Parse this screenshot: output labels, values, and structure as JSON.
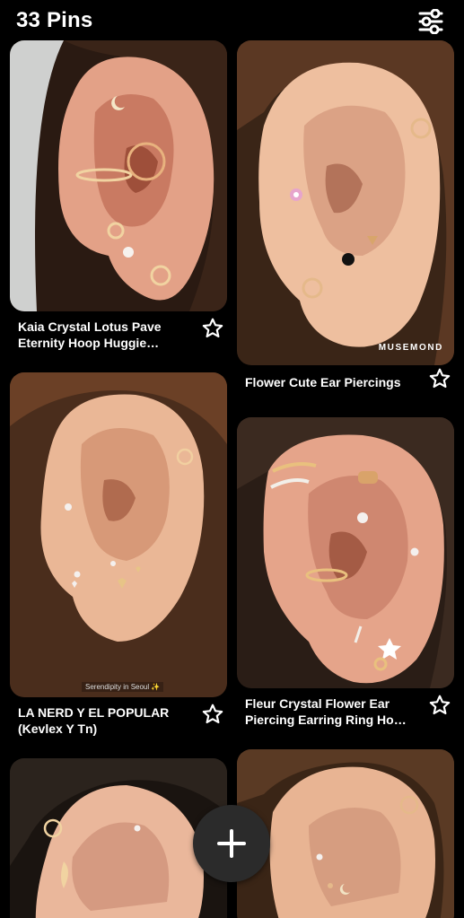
{
  "header": {
    "title": "33 Pins",
    "filter_icon": "sliders-icon"
  },
  "pins": [
    {
      "title": "Kaia Crystal Lotus Pave Eternity Hoop Huggie Earrin...",
      "image": "ear-piercings-moon-helix-daith"
    },
    {
      "title": "Flower Cute Ear Piercings",
      "image": "ear-piercings-flower-studs",
      "watermark": "MUSEMOND"
    },
    {
      "title": "LA NERD Y EL POPULAR (Kevlex Y Tn)",
      "image": "ear-piercings-star-studs",
      "watermark": "Serendipity in Seoul ✨"
    },
    {
      "title": "Fleur Crystal Flower Ear Piercing Earring Ring Hoop ...",
      "image": "ear-piercings-crystal-flower-hoops"
    },
    {
      "title": "",
      "image": "ear-piercings-leaf-helix"
    },
    {
      "title": "",
      "image": "ear-piercings-moon-lobe"
    }
  ],
  "fab": {
    "icon": "plus-icon"
  },
  "colors": {
    "background": "#000000",
    "fab": "#2b2b2b",
    "text": "#ffffff"
  }
}
